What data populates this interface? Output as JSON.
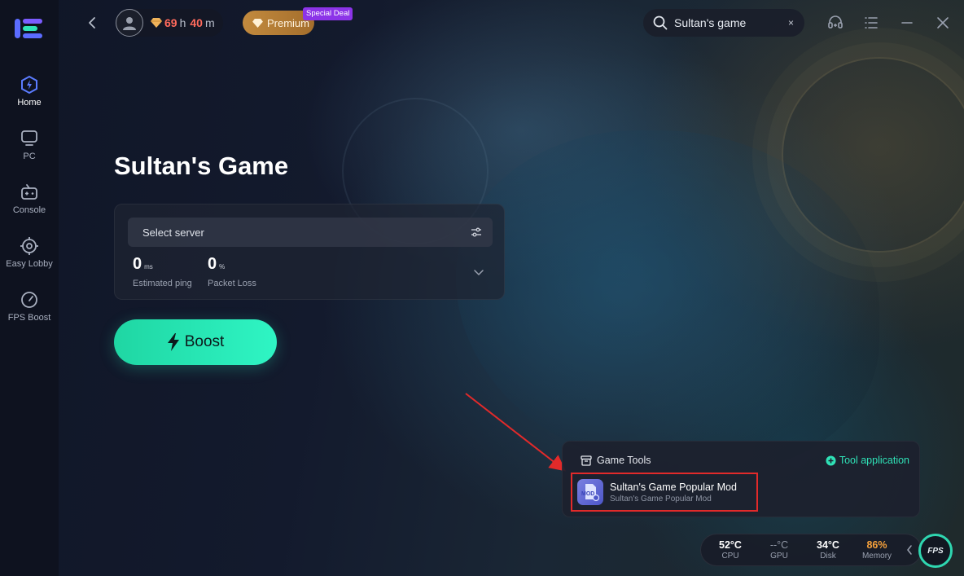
{
  "user": {
    "time_hours": "69",
    "time_h_unit": "h",
    "time_minutes": "40",
    "time_m_unit": "m"
  },
  "premium": {
    "label": "Premium",
    "badge": "Special Deal"
  },
  "search": {
    "value": "Sultan's game",
    "clear": "×"
  },
  "sidebar": {
    "items": [
      {
        "label": "Home",
        "icon": "home-icon"
      },
      {
        "label": "PC",
        "icon": "pc-icon"
      },
      {
        "label": "Console",
        "icon": "console-icon"
      },
      {
        "label": "Easy Lobby",
        "icon": "easy-lobby-icon"
      },
      {
        "label": "FPS Boost",
        "icon": "fps-boost-icon"
      }
    ]
  },
  "main": {
    "game_title": "Sultan's Game",
    "select_server": "Select server",
    "ping_value": "0",
    "ping_unit": "ms",
    "ping_label": "Estimated ping",
    "loss_value": "0",
    "loss_unit": "%",
    "loss_label": "Packet Loss",
    "boost_label": "Boost"
  },
  "tools": {
    "header": "Game Tools",
    "tool_application": "Tool application",
    "mod_title": "Sultan's Game Popular Mod",
    "mod_subtitle": "Sultan's Game Popular Mod",
    "mod_icon_text": "MOD"
  },
  "status": {
    "cpu_value": "52°C",
    "cpu_label": "CPU",
    "gpu_value": "--°C",
    "gpu_label": "GPU",
    "disk_value": "34°C",
    "disk_label": "Disk",
    "memory_value": "86%",
    "memory_label": "Memory",
    "fps_label": "FPS"
  },
  "colors": {
    "accent": "#2fe2b7",
    "boost_start": "#1fd6a3",
    "boost_end": "#2ff5c4",
    "highlight_box": "#e22a2a",
    "time_number": "#ff6a5c",
    "premium": "#c28a3e",
    "memory_warning": "#f6a13b"
  }
}
